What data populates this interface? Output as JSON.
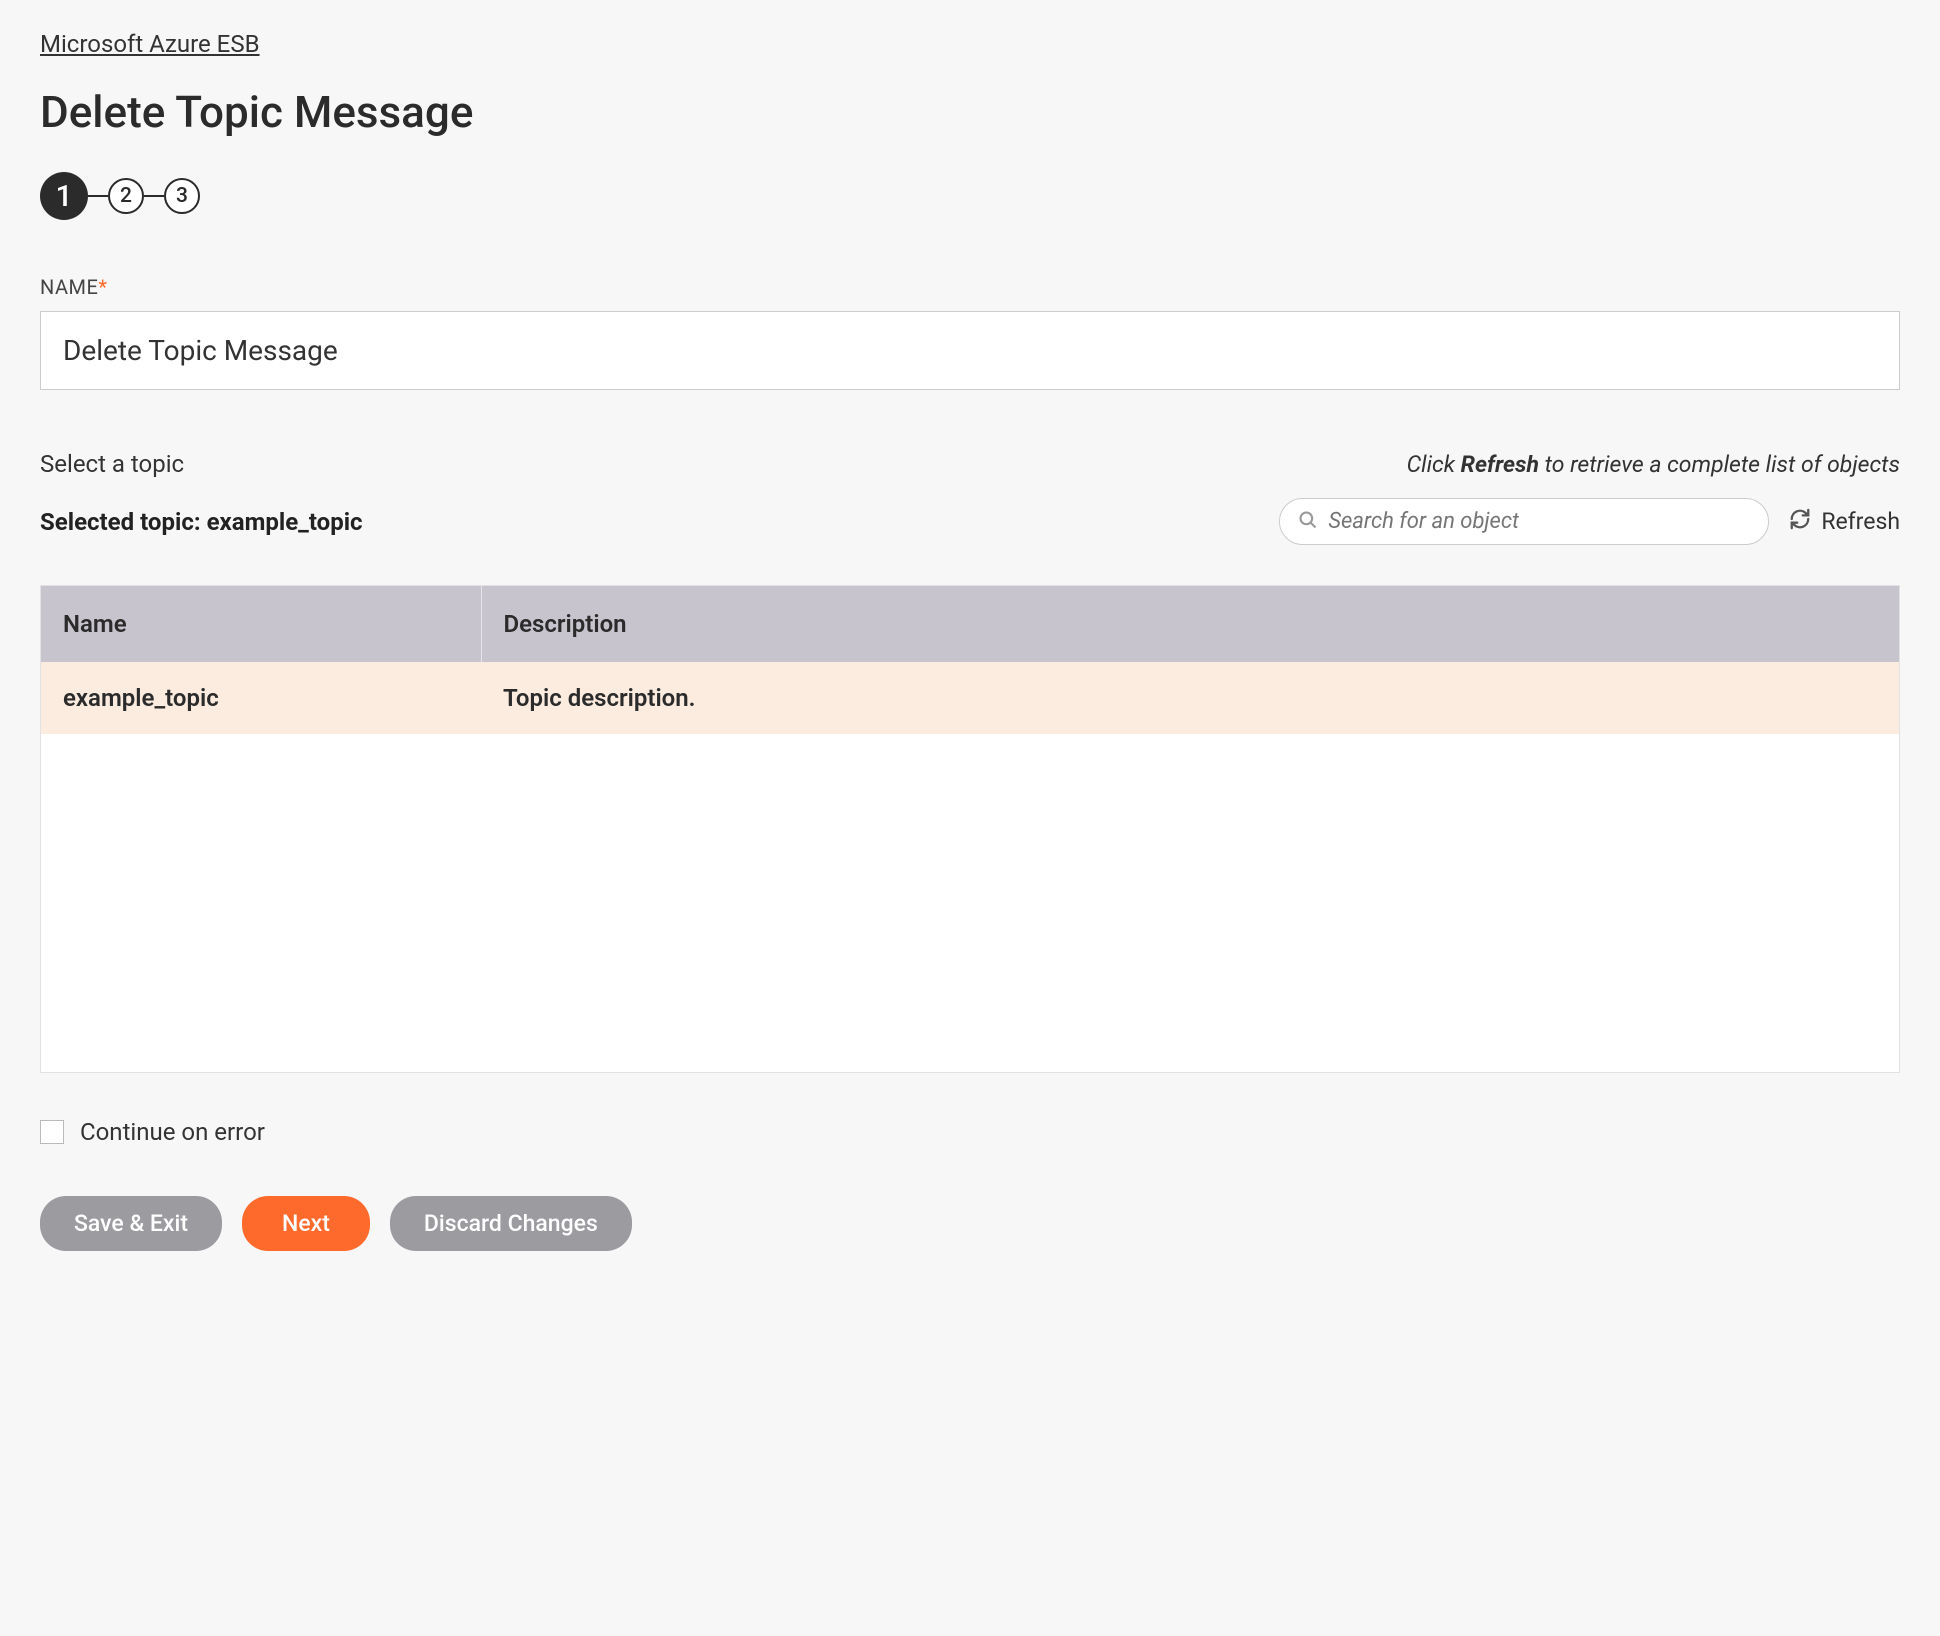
{
  "breadcrumb": "Microsoft Azure ESB",
  "page_title": "Delete Topic Message",
  "stepper": {
    "steps": [
      "1",
      "2",
      "3"
    ],
    "active_index": 0
  },
  "name_field": {
    "label": "NAME",
    "required_mark": "*",
    "value": "Delete Topic Message"
  },
  "topic_section": {
    "select_label": "Select a topic",
    "refresh_hint_pre": "Click ",
    "refresh_hint_bold": "Refresh",
    "refresh_hint_post": " to retrieve a complete list of objects",
    "selected_label_prefix": "Selected topic: ",
    "selected_name": "example_topic",
    "search_placeholder": "Search for an object",
    "refresh_label": "Refresh"
  },
  "table": {
    "headers": {
      "name": "Name",
      "description": "Description"
    },
    "rows": [
      {
        "name": "example_topic",
        "description": "Topic description.",
        "selected": true
      }
    ]
  },
  "continue_on_error_label": "Continue on error",
  "buttons": {
    "save_exit": "Save & Exit",
    "next": "Next",
    "discard": "Discard Changes"
  }
}
